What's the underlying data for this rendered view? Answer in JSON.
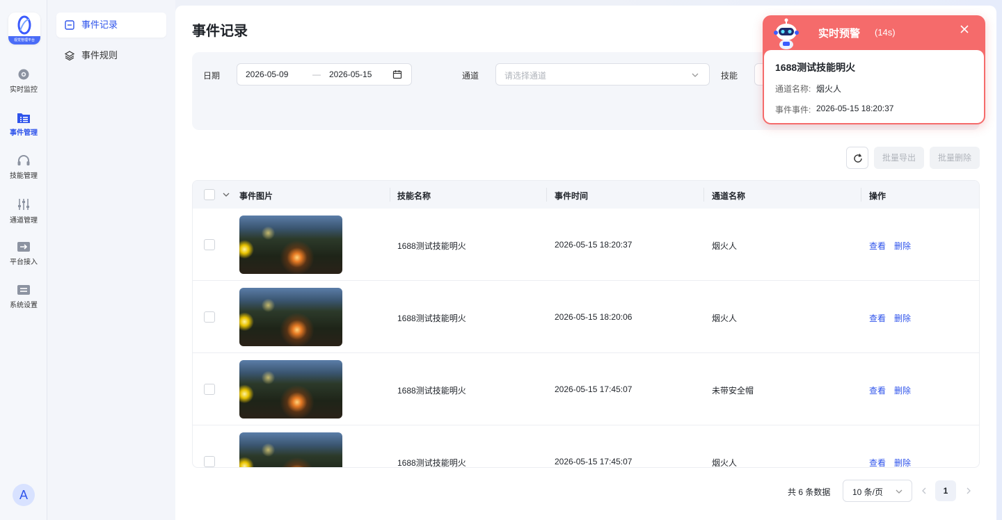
{
  "rail": {
    "logo_text": "视觉管理平台",
    "items": [
      {
        "label": "实时监控",
        "icon": "camera-icon"
      },
      {
        "label": "事件管理",
        "icon": "event-folder-icon"
      },
      {
        "label": "技能管理",
        "icon": "headset-icon"
      },
      {
        "label": "通道管理",
        "icon": "sliders-icon"
      },
      {
        "label": "平台接入",
        "icon": "access-icon"
      },
      {
        "label": "系统设置",
        "icon": "settings-icon"
      }
    ],
    "avatar": "A"
  },
  "submenu": {
    "items": [
      {
        "label": "事件记录",
        "icon": "list-icon"
      },
      {
        "label": "事件规则",
        "icon": "layers-icon"
      }
    ]
  },
  "page": {
    "title": "事件记录"
  },
  "filters": {
    "date_label": "日期",
    "date_start": "2026-05-09",
    "date_sep": "—",
    "date_end": "2026-05-15",
    "channel_label": "通道",
    "channel_placeholder": "请选择通道",
    "skill_label": "技能"
  },
  "toolbar": {
    "export_label": "批量导出",
    "delete_label": "批量删除"
  },
  "table": {
    "columns": [
      "事件图片",
      "技能名称",
      "事件时间",
      "通道名称",
      "操作"
    ],
    "rows": [
      {
        "skill": "1688测试技能明火",
        "time": "2026-05-15 18:20:37",
        "channel": "烟火人"
      },
      {
        "skill": "1688测试技能明火",
        "time": "2026-05-15 18:20:06",
        "channel": "烟火人"
      },
      {
        "skill": "1688测试技能明火",
        "time": "2026-05-15 17:45:07",
        "channel": "未带安全帽"
      },
      {
        "skill": "1688测试技能明火",
        "time": "2026-05-15 17:45:07",
        "channel": "烟火人"
      }
    ],
    "view_label": "查看",
    "delete_label": "删除"
  },
  "pagination": {
    "total_text": "共 6 条数据",
    "page_size": "10 条/页",
    "current_page": "1"
  },
  "alert": {
    "title": "实时预警",
    "countdown": "(14s)",
    "skill_name": "1688测试技能明火",
    "channel_key": "通道名称:",
    "channel_value": "烟火人",
    "event_key": "事件事件:",
    "event_value": "2026-05-15 18:20:37",
    "accent_color": "#f56b6b"
  }
}
